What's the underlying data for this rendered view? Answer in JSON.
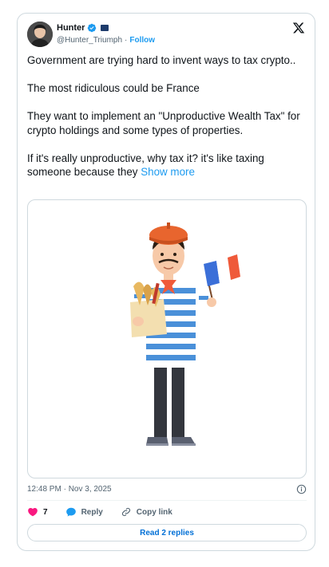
{
  "author": {
    "display_name": "Hunter",
    "handle": "@Hunter_Triumph",
    "separator": "·",
    "follow_label": "Follow"
  },
  "tweet": {
    "paragraphs": [
      "Government are trying hard to invent ways to tax crypto..",
      "The most ridiculous could be France",
      "They want to implement an \"Unproductive Wealth Tax\" for crypto holdings and some types of properties.",
      "If it's really unproductive, why tax it? it's like taxing someone because they"
    ],
    "show_more_label": "Show more"
  },
  "timestamp": "12:48 PM · Nov 3, 2025",
  "actions": {
    "like_count": "7",
    "reply_label": "Reply",
    "copy_link_label": "Copy link"
  },
  "read_replies_label": "Read 2 replies",
  "colors": {
    "accent": "#1d9bf0",
    "like": "#f91880",
    "border": "#cfd9de",
    "muted": "#536471"
  },
  "icons": [
    "verified-badge-icon",
    "x-logo-icon",
    "info-icon",
    "heart-icon",
    "reply-bubble-icon",
    "link-icon"
  ]
}
